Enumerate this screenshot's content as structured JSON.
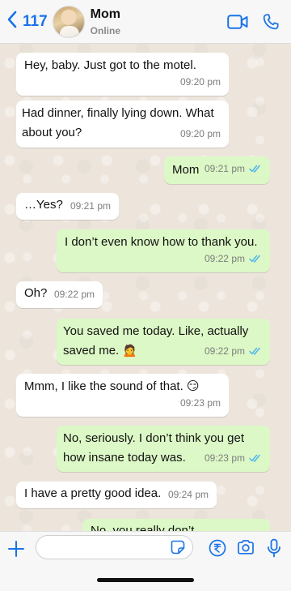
{
  "header": {
    "back_count": "117",
    "contact_name": "Mom",
    "contact_status": "Online"
  },
  "messages": [
    {
      "dir": "in",
      "text": "Hey, baby. Just got to the motel.",
      "time": "09:20 pm"
    },
    {
      "dir": "in",
      "text": "Had dinner, finally lying down. What about you?",
      "time": "09:20 pm"
    },
    {
      "dir": "out",
      "text": "Mom",
      "time": "09:21 pm",
      "read": true
    },
    {
      "dir": "in",
      "text": "…Yes?",
      "time": "09:21 pm"
    },
    {
      "dir": "out",
      "text": "I don’t even know how to thank you.",
      "time": "09:22 pm",
      "read": true
    },
    {
      "dir": "in",
      "text": "Oh?",
      "time": "09:22 pm"
    },
    {
      "dir": "out",
      "text": "You saved me today. Like, actually saved me. 🙍",
      "time": "09:22 pm",
      "read": true
    },
    {
      "dir": "in",
      "text": "Mmm, I like the sound of that. 😏",
      "time": "09:23 pm"
    },
    {
      "dir": "out",
      "text": "No, seriously. I don’t think you get how insane today was.",
      "time": "09:23 pm",
      "read": true
    },
    {
      "dir": "in",
      "text": "I have a pretty good idea.",
      "time": "09:24 pm"
    },
    {
      "dir": "out",
      "text": "No, you really don’t.",
      "time": "",
      "read": false
    }
  ],
  "input": {
    "placeholder": ""
  },
  "colors": {
    "accent": "#1a73e8",
    "incoming_bubble": "#ffffff",
    "outgoing_bubble": "#dcf8c6",
    "read_ticks": "#4fb6ec"
  },
  "icons": {
    "back": "chevron-left-icon",
    "video": "video-camera-icon",
    "call": "phone-icon",
    "attach": "plus-icon",
    "sticker": "sticker-icon",
    "payment": "rupee-icon",
    "camera": "camera-icon",
    "mic": "microphone-icon"
  }
}
